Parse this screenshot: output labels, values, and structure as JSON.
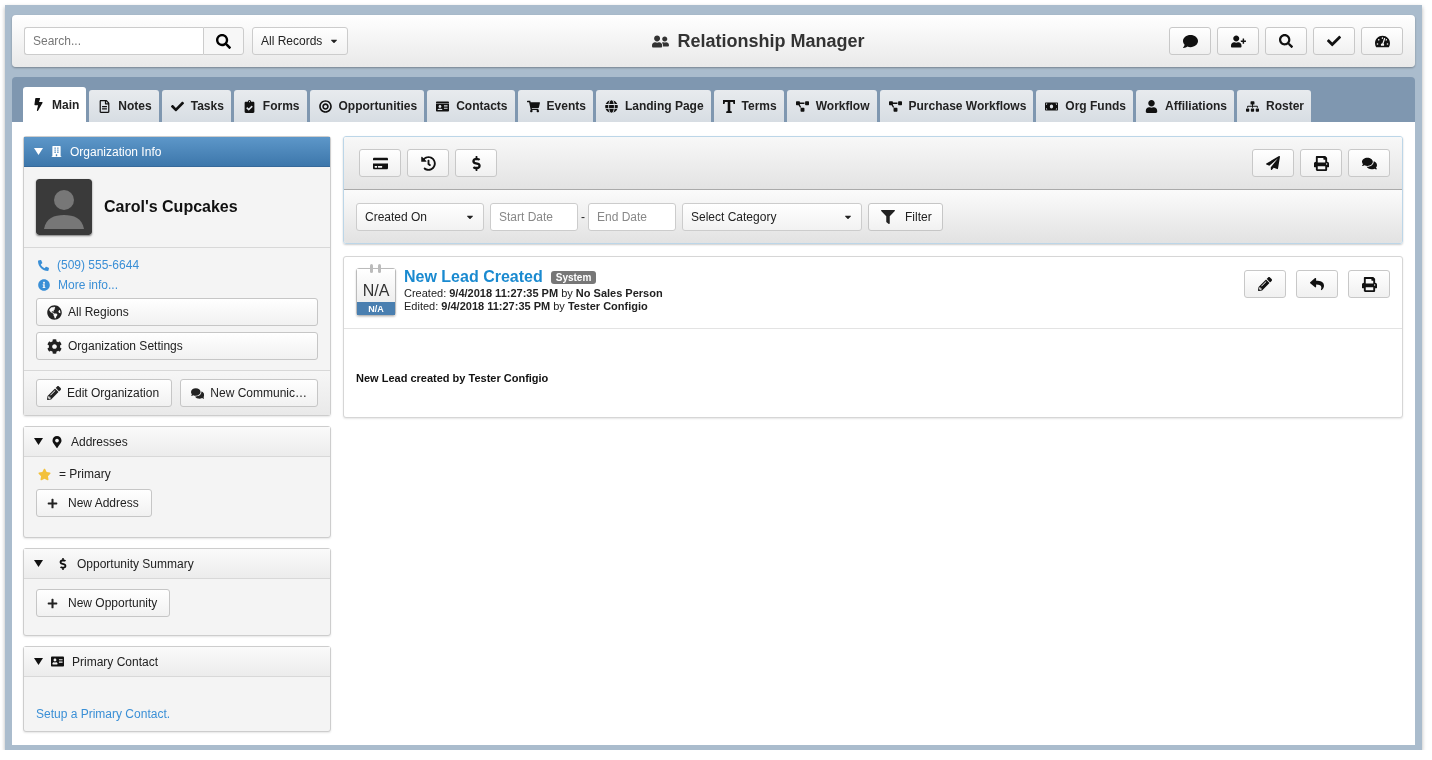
{
  "search": {
    "placeholder": "Search..."
  },
  "records_select": {
    "value": "All Records"
  },
  "app_title": "Relationship Manager",
  "tabs": [
    {
      "label": "Main",
      "selected": true
    },
    {
      "label": "Notes",
      "selected": false
    },
    {
      "label": "Tasks",
      "selected": false
    },
    {
      "label": "Forms",
      "selected": false
    },
    {
      "label": "Opportunities",
      "selected": false
    },
    {
      "label": "Contacts",
      "selected": false
    },
    {
      "label": "Events",
      "selected": false
    },
    {
      "label": "Landing Page",
      "selected": false
    },
    {
      "label": "Terms",
      "selected": false
    },
    {
      "label": "Workflow",
      "selected": false
    },
    {
      "label": "Purchase Workflows",
      "selected": false
    },
    {
      "label": "Org Funds",
      "selected": false
    },
    {
      "label": "Affiliations",
      "selected": false
    },
    {
      "label": "Roster",
      "selected": false
    }
  ],
  "org_panel": {
    "title": "Organization Info",
    "expanded": true,
    "name": "Carol's Cupcakes",
    "phone": "(509) 555-6644",
    "more_info": "More info...",
    "buttons": [
      "All Regions",
      "Organization Settings"
    ],
    "footer_buttons": [
      "Edit Organization",
      "New Communic…"
    ]
  },
  "addresses_panel": {
    "title": "Addresses",
    "expanded": true,
    "legend": "= Primary",
    "button": "New Address"
  },
  "opportunity_panel": {
    "title": "Opportunity Summary",
    "expanded": true,
    "button": "New Opportunity"
  },
  "contact_panel": {
    "title": "Primary Contact",
    "expanded": true,
    "link": "Setup a Primary Contact."
  },
  "filter": {
    "sort_select": "Created On",
    "start_date": {
      "placeholder": "Start Date"
    },
    "separator": "-",
    "end_date": {
      "placeholder": "End Date"
    },
    "category_select": "Select Category",
    "button": "Filter"
  },
  "entry": {
    "date_top": "N/A",
    "date_bottom": "N/A",
    "title": "New Lead Created",
    "tag": "System",
    "created": "Created: **9/4/2018 11:27:35 PM** by **No Sales Person**",
    "edited": "Edited: **9/4/2018 11:27:35 PM** by **Tester Configio**",
    "body": "New Lead created by Tester Configio"
  }
}
